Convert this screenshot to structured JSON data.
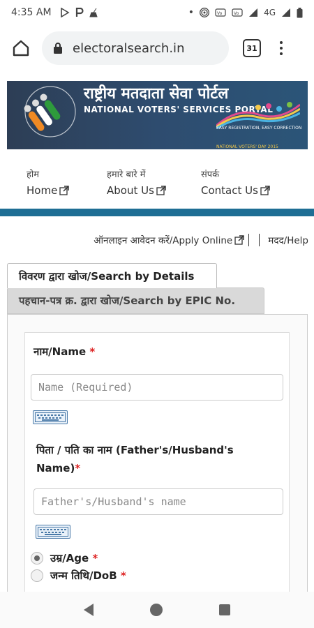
{
  "status_bar": {
    "time": "4:35 AM",
    "network": "4G"
  },
  "browser": {
    "url": "electoralsearch.in",
    "tab_count": "31"
  },
  "banner": {
    "hindi_title": "राष्ट्रीय मतदाता सेवा पोर्टल",
    "english_title": "NATIONAL VOTERS' SERVICES PORTAL",
    "tagline": "EASY REGISTRATION, EASY CORRECTION",
    "footer": "NATIONAL VOTERS' DAY 2015"
  },
  "nav": {
    "items": [
      {
        "hindi": "होम",
        "english": "Home"
      },
      {
        "hindi": "हमारे बारे में",
        "english": "About Us"
      },
      {
        "hindi": "संपर्क",
        "english": "Contact Us"
      }
    ]
  },
  "links": {
    "apply_online": "ऑनलाइन आवेदन करें/Apply Online",
    "help": "मदद/Help"
  },
  "tabs": {
    "search_by_details": "विवरण द्वारा खोज/Search by Details",
    "search_by_epic": "पहचान-पत्र क्र. द्वारा खोज/Search by EPIC No."
  },
  "form": {
    "name_label": "नाम/Name",
    "name_placeholder": "Name (Required)",
    "father_label_line1": "पिता / पति का नाम (Father's/Husband's",
    "father_label_line2": "Name)",
    "father_placeholder": "Father's/Husband's name",
    "required_mark": "*",
    "age_label": "उम्र/Age",
    "dob_label": "जन्म तिथि/DoB",
    "age_selected": true
  },
  "colors": {
    "nav_bar": "#1e6e94",
    "required": "#dd2222",
    "banner_bg": "#2e4c6f"
  }
}
